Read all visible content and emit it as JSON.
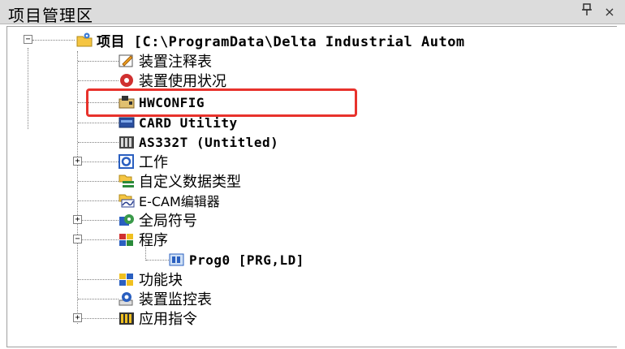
{
  "panel": {
    "title": "项目管理区",
    "pin_glyph": "♦",
    "close_glyph": "×"
  },
  "tree": {
    "root": {
      "label": "项目 [C:\\ProgramData\\Delta Industrial Autom",
      "icon": "project-folder-icon",
      "expander": "−"
    },
    "items": [
      {
        "label": "装置注释表",
        "icon": "device-comment-icon"
      },
      {
        "label": "装置使用状况",
        "icon": "device-usage-icon"
      },
      {
        "label": "HWCONFIG",
        "icon": "hardware-config-icon"
      },
      {
        "label": "CARD Utility",
        "icon": "card-utility-icon"
      },
      {
        "label": "AS332T  (Untitled)",
        "icon": "plc-module-icon"
      },
      {
        "label": "工作",
        "icon": "task-gear-icon",
        "expander": "+"
      },
      {
        "label": "自定义数据类型",
        "icon": "custom-data-type-icon"
      },
      {
        "label": "E-CAM编辑器",
        "icon": "ecam-editor-icon"
      },
      {
        "label": "全局符号",
        "icon": "global-symbols-icon",
        "expander": "+"
      },
      {
        "label": "程序",
        "icon": "program-icon",
        "expander": "−"
      },
      {
        "label": "Prog0 [PRG,LD]",
        "icon": "program-unit-icon"
      },
      {
        "label": "功能块",
        "icon": "function-block-icon"
      },
      {
        "label": "装置监控表",
        "icon": "device-monitor-icon"
      },
      {
        "label": "应用指令",
        "icon": "app-instruction-icon",
        "expander": "+"
      }
    ]
  },
  "colors": {
    "highlight": "#e8322c",
    "titlebar": "#dcdcdc"
  }
}
